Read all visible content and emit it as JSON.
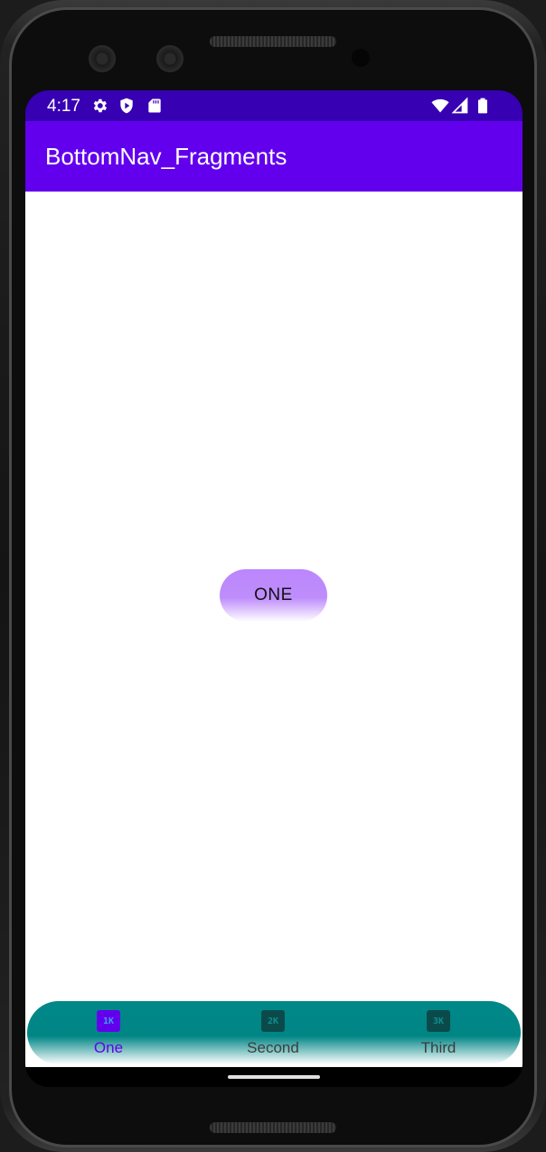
{
  "status_bar": {
    "time": "4:17",
    "icons": [
      "settings-gear-icon",
      "shield-play-icon",
      "sd-card-icon",
      "wifi-icon",
      "signal-icon",
      "battery-icon"
    ]
  },
  "app_bar": {
    "title": "BottomNav_Fragments"
  },
  "content": {
    "button_label": "ONE"
  },
  "bottom_nav": {
    "items": [
      {
        "label": "One",
        "icon_text": "1K",
        "active": true
      },
      {
        "label": "Second",
        "icon_text": "2K",
        "active": false
      },
      {
        "label": "Third",
        "icon_text": "3K",
        "active": false
      }
    ]
  },
  "colors": {
    "status_bar": "#3700b3",
    "primary": "#6200ee",
    "button": "#bb86fc",
    "bottom_nav": "#008888"
  }
}
